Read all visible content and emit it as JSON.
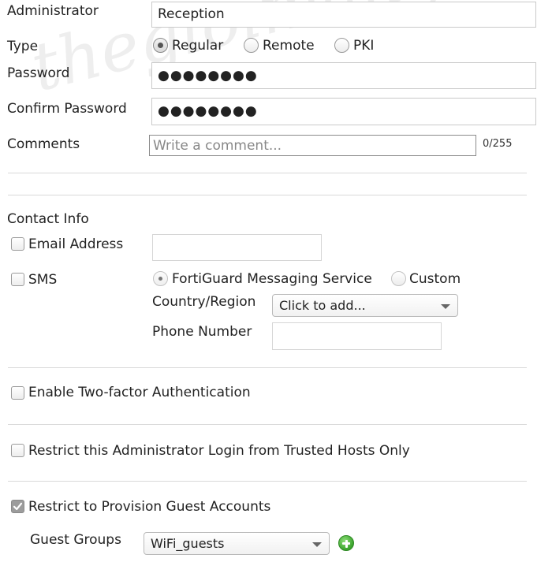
{
  "watermark": "thegioimang.vn",
  "administrator": {
    "label": "Administrator",
    "value": "Reception"
  },
  "type": {
    "label": "Type",
    "options": [
      "Regular",
      "Remote",
      "PKI"
    ],
    "selected": "Regular"
  },
  "password": {
    "label": "Password",
    "value": "●●●●●●●●"
  },
  "confirm_password": {
    "label": "Confirm Password",
    "value": "●●●●●●●●"
  },
  "comments": {
    "label": "Comments",
    "placeholder": "Write a comment...",
    "counter": "0/255"
  },
  "contact_info": {
    "heading": "Contact Info",
    "email": {
      "label": "Email Address",
      "checked": false,
      "value": ""
    },
    "sms": {
      "label": "SMS",
      "checked": false,
      "service_options": [
        "FortiGuard Messaging Service",
        "Custom"
      ],
      "selected_service": "FortiGuard Messaging Service",
      "country_label": "Country/Region",
      "country_value": "Click to add...",
      "phone_label": "Phone Number",
      "phone_value": ""
    }
  },
  "two_factor": {
    "label": "Enable Two-factor Authentication",
    "checked": false
  },
  "trusted_hosts": {
    "label": "Restrict this Administrator Login from Trusted Hosts Only",
    "checked": false
  },
  "guest_provision": {
    "label": "Restrict to Provision Guest Accounts",
    "checked": true
  },
  "guest_groups": {
    "label": "Guest Groups",
    "value": "WiFi_guests",
    "add_icon": "plus-circle-icon"
  },
  "colors": {
    "add_button": "#3aa22c",
    "checked_box": "#9c9c9c",
    "divider": "#d9d9d9"
  }
}
